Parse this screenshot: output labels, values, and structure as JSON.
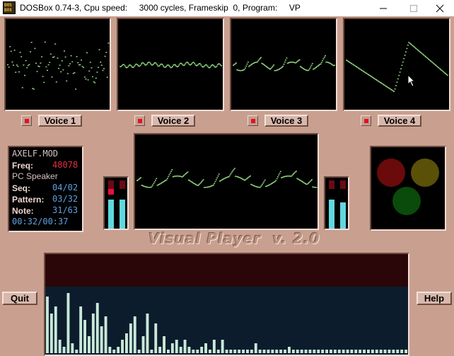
{
  "window": {
    "title": "DOSBox 0.74-3, Cpu speed:     3000 cycles, Frameskip  0, Program:     VP",
    "icon_text_top": "DOS",
    "icon_text_bottom": "BOX"
  },
  "voices": [
    {
      "label": "Voice 1",
      "active": true
    },
    {
      "label": "Voice 2",
      "active": true
    },
    {
      "label": "Voice 3",
      "active": true
    },
    {
      "label": "Voice 4",
      "active": true
    }
  ],
  "info": {
    "module": "AXELF.MOD",
    "freq_label": "Freq:",
    "freq_value": "48078",
    "device": "PC Speaker",
    "seq_label": "Seq:",
    "seq_value": "04/02",
    "pattern_label": "Pattern:",
    "pattern_value": "03/32",
    "note_label": "Note:",
    "note_value": "31/63",
    "time": "00:32/00:37"
  },
  "logo": "Visual Player  v. 2.0",
  "buttons": {
    "quit": "Quit",
    "help": "Help"
  },
  "colors": {
    "panel_bg": "#c9a090",
    "wave": "#8fd27f",
    "led_on": "#e8101c",
    "vu_level": "#60d8e0",
    "light_red": "#6a0a0a",
    "light_yellow": "#5a5008",
    "light_green": "#0a4a0a"
  },
  "vu_left_levels": [
    0.6,
    0.6
  ],
  "vu_right_levels": [
    0.6,
    0.55
  ],
  "spectrum_levels": [
    0.85,
    0.6,
    0.7,
    0.2,
    0.1,
    0.9,
    0.15,
    0.05,
    0.7,
    0.5,
    0.25,
    0.6,
    0.75,
    0.4,
    0.55,
    0.1,
    0.05,
    0.1,
    0.2,
    0.3,
    0.45,
    0.55,
    0.05,
    0.25,
    0.6,
    0.05,
    0.45,
    0.1,
    0.25,
    0.05,
    0.15,
    0.2,
    0.1,
    0.2,
    0.1,
    0.05,
    0.05,
    0.1,
    0.15,
    0.05,
    0.2,
    0.05,
    0.2,
    0.05,
    0.05,
    0.05,
    0.05,
    0.05,
    0.05,
    0.05,
    0.15,
    0.05,
    0.05,
    0.05,
    0.05,
    0.05,
    0.05,
    0.05,
    0.1,
    0.05,
    0.05,
    0.05,
    0.05,
    0.05,
    0.05,
    0.05,
    0.05,
    0.05,
    0.05,
    0.05,
    0.05,
    0.05,
    0.05,
    0.05,
    0.05,
    0.05,
    0.05,
    0.05,
    0.05,
    0.05,
    0.05,
    0.05,
    0.05,
    0.05,
    0.05,
    0.05,
    0.05
  ]
}
